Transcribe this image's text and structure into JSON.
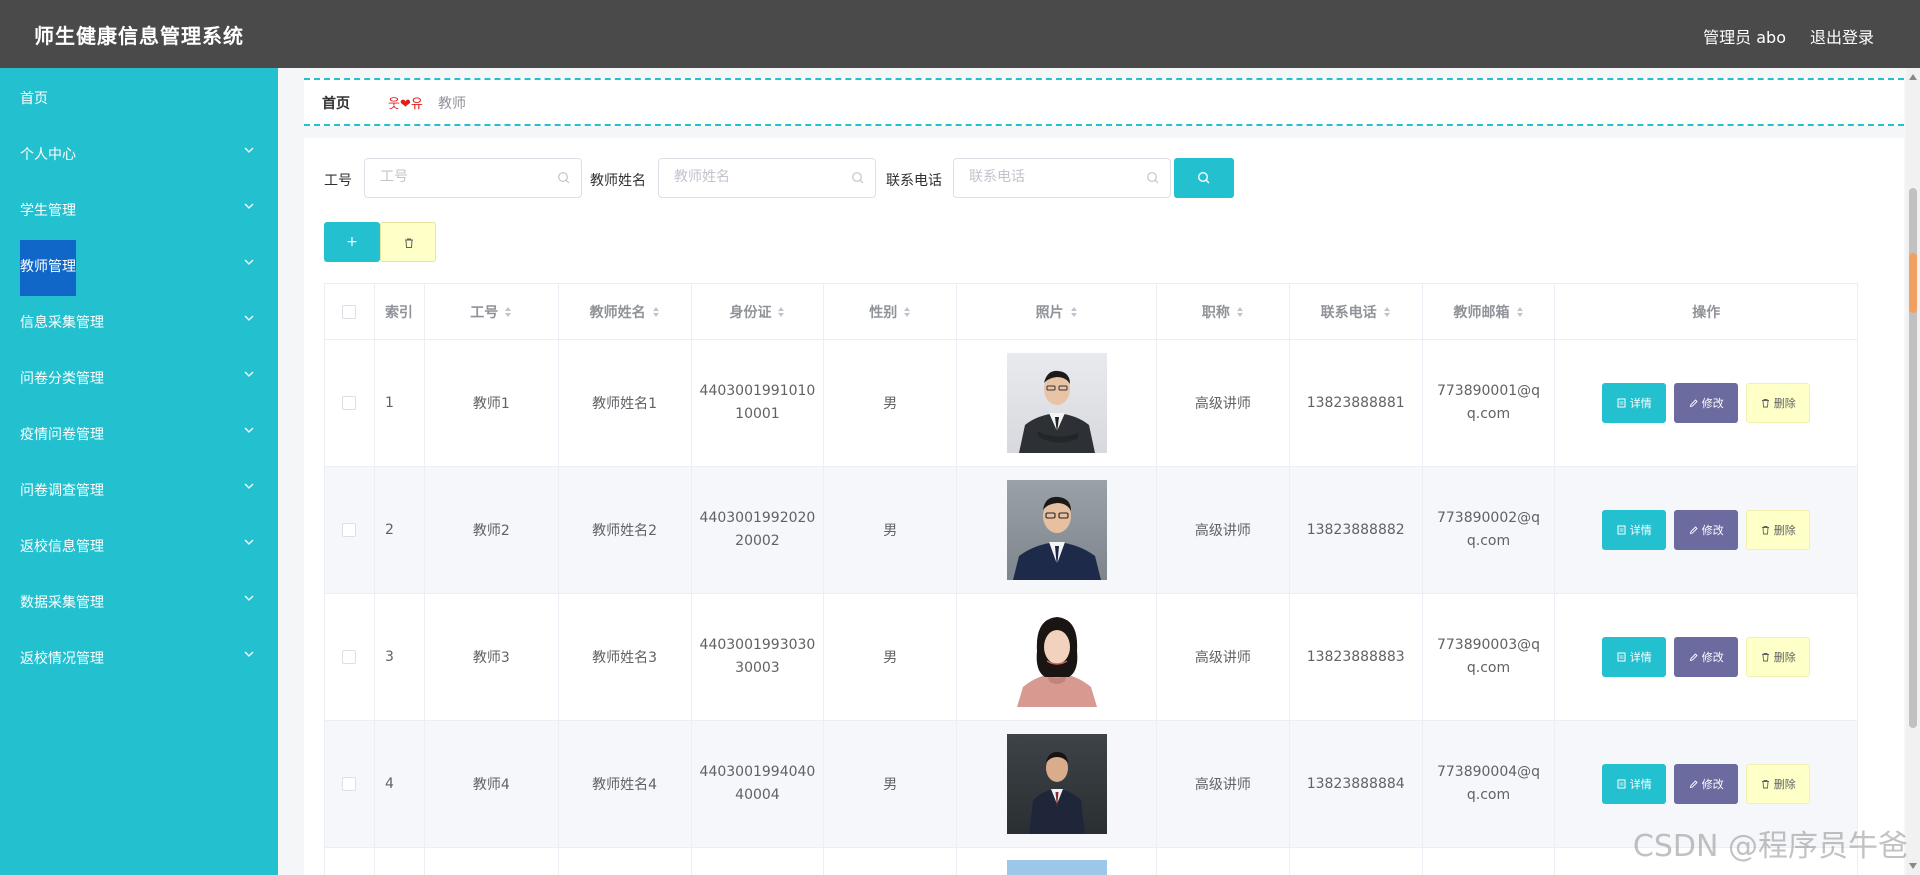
{
  "header": {
    "title": "师生健康信息管理系统",
    "user": "管理员 abo",
    "logout": "退出登录"
  },
  "sidebar": {
    "items": [
      {
        "label": "首页",
        "chevron": false
      },
      {
        "label": "个人中心",
        "chevron": true
      },
      {
        "label": "学生管理",
        "chevron": true
      },
      {
        "label": "教师管理",
        "chevron": true,
        "active": true
      },
      {
        "label": "信息采集管理",
        "chevron": true
      },
      {
        "label": "问卷分类管理",
        "chevron": true
      },
      {
        "label": "疫情问卷管理",
        "chevron": true
      },
      {
        "label": "问卷调查管理",
        "chevron": true
      },
      {
        "label": "返校信息管理",
        "chevron": true
      },
      {
        "label": "数据采集管理",
        "chevron": true
      },
      {
        "label": "返校情况管理",
        "chevron": true
      }
    ]
  },
  "breadcrumb": {
    "home": "首页",
    "separator": "웃❤유",
    "current": "教师"
  },
  "search": {
    "fields": [
      {
        "label": "工号",
        "placeholder": "工号"
      },
      {
        "label": "教师姓名",
        "placeholder": "教师姓名"
      },
      {
        "label": "联系电话",
        "placeholder": "联系电话"
      }
    ]
  },
  "toolbar": {
    "add_label": "+"
  },
  "table": {
    "headers": [
      "索引",
      "工号",
      "教师姓名",
      "身份证",
      "性别",
      "照片",
      "职称",
      "联系电话",
      "教师邮箱",
      "操作"
    ],
    "rows": [
      {
        "index": "1",
        "id": "教师1",
        "name": "教师姓名1",
        "idcard": "440300199101010001",
        "gender": "男",
        "title": "高级讲师",
        "phone": "13823888881",
        "email": "773890001@qq.com"
      },
      {
        "index": "2",
        "id": "教师2",
        "name": "教师姓名2",
        "idcard": "440300199202020002",
        "gender": "男",
        "title": "高级讲师",
        "phone": "13823888882",
        "email": "773890002@qq.com"
      },
      {
        "index": "3",
        "id": "教师3",
        "name": "教师姓名3",
        "idcard": "440300199303030003",
        "gender": "男",
        "title": "高级讲师",
        "phone": "13823888883",
        "email": "773890003@qq.com"
      },
      {
        "index": "4",
        "id": "教师4",
        "name": "教师姓名4",
        "idcard": "440300199404040004",
        "gender": "男",
        "title": "高级讲师",
        "phone": "13823888884",
        "email": "773890004@qq.com"
      }
    ],
    "actions": {
      "detail": "详情",
      "edit": "修改",
      "remove": "删除"
    }
  },
  "watermark": "CSDN @程序员牛爸",
  "colors": {
    "header_bg": "#4a4a4a",
    "sidebar_bg": "#23c1d0",
    "active_item": "#1167c7",
    "primary": "#23c1d0",
    "edit": "#6c6ba0",
    "danger_bg": "#ffffc8"
  }
}
